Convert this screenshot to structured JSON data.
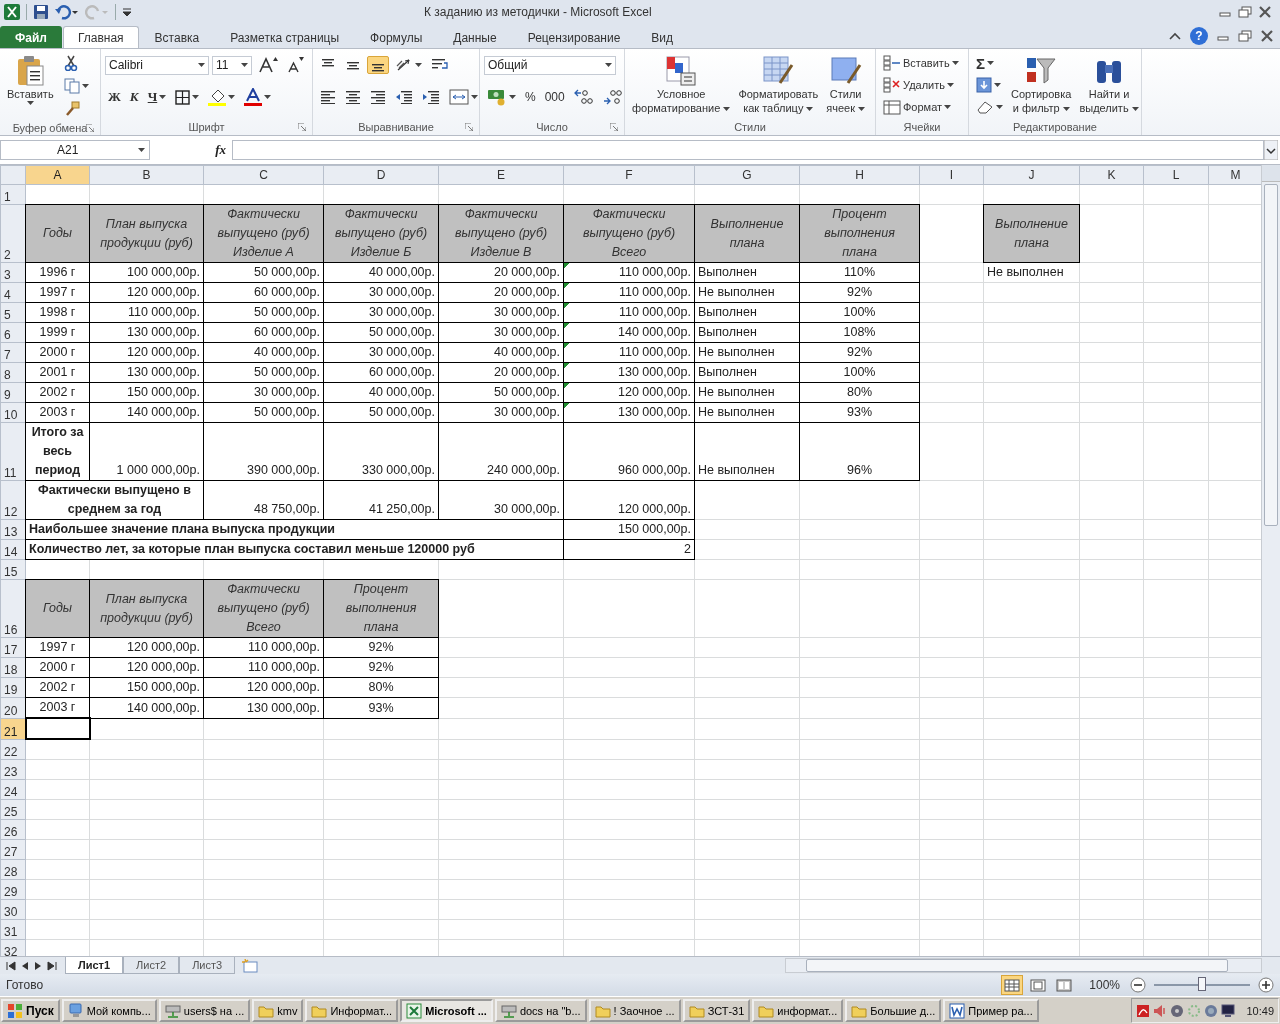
{
  "window": {
    "title": "К заданию из методички  -  Microsoft Excel"
  },
  "ribbon_tabs": [
    {
      "label": "Файл",
      "kind": "file",
      "selected": false
    },
    {
      "label": "Главная",
      "kind": "tab",
      "selected": true
    },
    {
      "label": "Вставка",
      "kind": "tab",
      "selected": false
    },
    {
      "label": "Разметка страницы",
      "kind": "tab",
      "selected": false
    },
    {
      "label": "Формулы",
      "kind": "tab",
      "selected": false
    },
    {
      "label": "Данные",
      "kind": "tab",
      "selected": false
    },
    {
      "label": "Рецензирование",
      "kind": "tab",
      "selected": false
    },
    {
      "label": "Вид",
      "kind": "tab",
      "selected": false
    }
  ],
  "help_button": "?",
  "ribbon_groups": [
    {
      "label": "Буфер обмена",
      "kind": "clipboard",
      "launcher": true,
      "items": [
        {
          "kind": "paste",
          "label": "Вставить",
          "dropdown": true
        },
        {
          "kind": "cut"
        },
        {
          "kind": "copy",
          "dropdown": true
        },
        {
          "kind": "painter"
        }
      ]
    },
    {
      "label": "Шрифт",
      "kind": "font",
      "launcher": true,
      "upper_items": [
        {
          "kind": "font-field",
          "value": "Calibri"
        },
        {
          "kind": "size-field",
          "value": "11"
        },
        {
          "kind": "grow"
        },
        {
          "kind": "shrink"
        }
      ],
      "lower_items": [
        {
          "kind": "bold",
          "label": "Ж"
        },
        {
          "kind": "italic",
          "label": "К"
        },
        {
          "kind": "underline",
          "label": "Ч",
          "dropdown": true
        },
        {
          "kind": "borders",
          "dropdown": true
        },
        {
          "kind": "fill",
          "dropdown": true
        },
        {
          "kind": "font-color",
          "dropdown": true
        }
      ]
    },
    {
      "label": "Выравнивание",
      "kind": "alignment",
      "launcher": true,
      "upper_items": [
        {
          "kind": "align-top",
          "selected": false
        },
        {
          "kind": "align-middle",
          "selected": false
        },
        {
          "kind": "align-bottom",
          "selected": true
        },
        {
          "kind": "orientation",
          "dropdown": true,
          "selected": false
        },
        {
          "kind": "wrap",
          "selected": false
        }
      ],
      "lower_items": [
        {
          "kind": "align-left",
          "selected": false
        },
        {
          "kind": "align-center",
          "selected": false
        },
        {
          "kind": "align-right",
          "selected": false
        },
        {
          "kind": "outdent",
          "selected": false
        },
        {
          "kind": "indent",
          "selected": false
        },
        {
          "kind": "merge",
          "dropdown": true,
          "selected": false
        }
      ]
    },
    {
      "label": "Число",
      "kind": "number",
      "launcher": true,
      "upper_items": [
        {
          "kind": "format-field",
          "value": "Общий"
        }
      ],
      "lower_items": [
        {
          "kind": "currency",
          "dropdown": true
        },
        {
          "kind": "percent",
          "label": "%"
        },
        {
          "kind": "thousands",
          "label": "000"
        },
        {
          "kind": "increase-decimal"
        },
        {
          "kind": "decrease-decimal"
        }
      ]
    },
    {
      "label": "Стили",
      "kind": "styles",
      "items": [
        {
          "kind": "conditional",
          "lines": [
            "Условное",
            "форматирование"
          ],
          "dropdown": true
        },
        {
          "kind": "as-table",
          "lines": [
            "Форматировать",
            "как таблицу"
          ],
          "dropdown": true
        },
        {
          "kind": "cell-styles",
          "lines": [
            "Стили",
            "ячеек"
          ],
          "dropdown": true
        }
      ]
    },
    {
      "label": "Ячейки",
      "kind": "cells",
      "items": [
        {
          "kind": "insert",
          "label": "Вставить",
          "dropdown": true
        },
        {
          "kind": "delete",
          "label": "Удалить",
          "dropdown": true
        },
        {
          "kind": "format",
          "label": "Формат",
          "dropdown": true
        }
      ]
    },
    {
      "label": "Редактирование",
      "kind": "editing",
      "items": [
        {
          "kind": "sum",
          "label": "Σ",
          "dropdown": true
        },
        {
          "kind": "fill-down",
          "dropdown": true
        },
        {
          "kind": "clear",
          "dropdown": true
        },
        {
          "kind": "sort",
          "lines": [
            "Сортировка",
            "и фильтр"
          ],
          "dropdown": true
        },
        {
          "kind": "find",
          "lines": [
            "Найти и",
            "выделить"
          ],
          "dropdown": true
        }
      ]
    }
  ],
  "formula_bar": {
    "name_box": "A21",
    "function_label": "fx"
  },
  "sheet": {
    "columns": [
      {
        "label": "A",
        "selected": true
      },
      {
        "label": "B",
        "selected": false
      },
      {
        "label": "C",
        "selected": false
      },
      {
        "label": "D",
        "selected": false
      },
      {
        "label": "E",
        "selected": false
      },
      {
        "label": "F",
        "selected": false
      },
      {
        "label": "G",
        "selected": false
      },
      {
        "label": "H",
        "selected": false
      },
      {
        "label": "I",
        "selected": false
      },
      {
        "label": "J",
        "selected": false
      },
      {
        "label": "K",
        "selected": false
      },
      {
        "label": "L",
        "selected": false
      },
      {
        "label": "M",
        "selected": false
      }
    ],
    "rows": [
      {
        "number": "1",
        "selected": false,
        "cells": []
      },
      {
        "number": "2",
        "selected": false,
        "cells": [
          {
            "kind": "header",
            "lines": [
              "Годы"
            ]
          },
          {
            "kind": "header",
            "lines": [
              "План выпуска",
              "продукции (руб)"
            ]
          },
          {
            "kind": "header",
            "lines": [
              "Фактически",
              "выпущено (руб)",
              "Изделие А"
            ]
          },
          {
            "kind": "header",
            "lines": [
              "Фактически",
              "выпущено (руб)",
              "Изделие Б"
            ]
          },
          {
            "kind": "header",
            "lines": [
              "Фактически",
              "выпущено (руб)",
              "Изделие В"
            ]
          },
          {
            "kind": "header",
            "lines": [
              "Фактически",
              "выпущено (руб)",
              "Всего"
            ]
          },
          {
            "kind": "header",
            "lines": [
              "Выполнение",
              "плана"
            ]
          },
          {
            "kind": "header",
            "lines": [
              "Процент",
              "выполнения",
              "плана"
            ]
          },
          {
            "kind": "empty"
          },
          {
            "kind": "header",
            "lines": [
              "Выполнение",
              "плана"
            ]
          }
        ]
      },
      {
        "number": "3",
        "selected": false,
        "cells": [
          {
            "kind": "center",
            "text": "1996 г"
          },
          {
            "kind": "num",
            "text": "100 000,00р."
          },
          {
            "kind": "num",
            "text": "50 000,00р."
          },
          {
            "kind": "num",
            "text": "40 000,00р."
          },
          {
            "kind": "num",
            "text": "20 000,00р."
          },
          {
            "kind": "num",
            "text": "110 000,00р.",
            "flag": true
          },
          {
            "kind": "text",
            "text": "Выполнен"
          },
          {
            "kind": "center",
            "text": "110%"
          },
          {
            "kind": "empty"
          },
          {
            "kind": "plain",
            "text": "Не выполнен"
          }
        ]
      },
      {
        "number": "4",
        "selected": false,
        "cells": [
          {
            "kind": "center",
            "text": "1997 г"
          },
          {
            "kind": "num",
            "text": "120 000,00р."
          },
          {
            "kind": "num",
            "text": "60 000,00р."
          },
          {
            "kind": "num",
            "text": "30 000,00р."
          },
          {
            "kind": "num",
            "text": "20 000,00р."
          },
          {
            "kind": "num",
            "text": "110 000,00р.",
            "flag": true
          },
          {
            "kind": "text",
            "text": "Не выполнен"
          },
          {
            "kind": "center",
            "text": "92%"
          }
        ]
      },
      {
        "number": "5",
        "selected": false,
        "cells": [
          {
            "kind": "center",
            "text": "1998 г"
          },
          {
            "kind": "num",
            "text": "110 000,00р."
          },
          {
            "kind": "num",
            "text": "50 000,00р."
          },
          {
            "kind": "num",
            "text": "30 000,00р."
          },
          {
            "kind": "num",
            "text": "30 000,00р."
          },
          {
            "kind": "num",
            "text": "110 000,00р.",
            "flag": true
          },
          {
            "kind": "text",
            "text": "Выполнен"
          },
          {
            "kind": "center",
            "text": "100%"
          }
        ]
      },
      {
        "number": "6",
        "selected": false,
        "cells": [
          {
            "kind": "center",
            "text": "1999 г"
          },
          {
            "kind": "num",
            "text": "130 000,00р."
          },
          {
            "kind": "num",
            "text": "60 000,00р."
          },
          {
            "kind": "num",
            "text": "50 000,00р."
          },
          {
            "kind": "num",
            "text": "30 000,00р."
          },
          {
            "kind": "num",
            "text": "140 000,00р.",
            "flag": true
          },
          {
            "kind": "text",
            "text": "Выполнен"
          },
          {
            "kind": "center",
            "text": "108%"
          }
        ]
      },
      {
        "number": "7",
        "selected": false,
        "cells": [
          {
            "kind": "center",
            "text": "2000 г"
          },
          {
            "kind": "num",
            "text": "120 000,00р."
          },
          {
            "kind": "num",
            "text": "40 000,00р."
          },
          {
            "kind": "num",
            "text": "30 000,00р."
          },
          {
            "kind": "num",
            "text": "40 000,00р."
          },
          {
            "kind": "num",
            "text": "110 000,00р.",
            "flag": true
          },
          {
            "kind": "text",
            "text": "Не выполнен"
          },
          {
            "kind": "center",
            "text": "92%"
          }
        ]
      },
      {
        "number": "8",
        "selected": false,
        "cells": [
          {
            "kind": "center",
            "text": "2001 г"
          },
          {
            "kind": "num",
            "text": "130 000,00р."
          },
          {
            "kind": "num",
            "text": "50 000,00р."
          },
          {
            "kind": "num",
            "text": "60 000,00р."
          },
          {
            "kind": "num",
            "text": "20 000,00р."
          },
          {
            "kind": "num",
            "text": "130 000,00р.",
            "flag": true
          },
          {
            "kind": "text",
            "text": "Выполнен"
          },
          {
            "kind": "center",
            "text": "100%"
          }
        ]
      },
      {
        "number": "9",
        "selected": false,
        "cells": [
          {
            "kind": "center",
            "text": "2002 г"
          },
          {
            "kind": "num",
            "text": "150 000,00р."
          },
          {
            "kind": "num",
            "text": "30 000,00р."
          },
          {
            "kind": "num",
            "text": "40 000,00р."
          },
          {
            "kind": "num",
            "text": "50 000,00р."
          },
          {
            "kind": "num",
            "text": "120 000,00р.",
            "flag": true
          },
          {
            "kind": "text",
            "text": "Не выполнен"
          },
          {
            "kind": "center",
            "text": "80%"
          }
        ]
      },
      {
        "number": "10",
        "selected": false,
        "cells": [
          {
            "kind": "center",
            "text": "2003 г"
          },
          {
            "kind": "num",
            "text": "140 000,00р."
          },
          {
            "kind": "num",
            "text": "50 000,00р."
          },
          {
            "kind": "num",
            "text": "50 000,00р."
          },
          {
            "kind": "num",
            "text": "30 000,00р."
          },
          {
            "kind": "num",
            "text": "130 000,00р.",
            "flag": true
          },
          {
            "kind": "text",
            "text": "Не выполнен"
          },
          {
            "kind": "center",
            "text": "93%"
          }
        ]
      },
      {
        "number": "11",
        "selected": false,
        "cells": [
          {
            "kind": "bold",
            "lines": [
              "Итого за",
              "весь",
              "период"
            ]
          },
          {
            "kind": "num",
            "text": "1 000 000,00р."
          },
          {
            "kind": "num",
            "text": "390 000,00р."
          },
          {
            "kind": "num",
            "text": "330 000,00р."
          },
          {
            "kind": "num",
            "text": "240 000,00р."
          },
          {
            "kind": "num",
            "text": "960 000,00р."
          },
          {
            "kind": "text",
            "text": "Не выполнен"
          },
          {
            "kind": "center",
            "text": "96%"
          }
        ]
      },
      {
        "number": "12",
        "selected": false,
        "cells": [
          {
            "kind": "bold",
            "lines": [
              "Фактически выпущено в",
              "среднем за год"
            ],
            "colspan": 2
          },
          {
            "kind": "num",
            "text": "48 750,00р."
          },
          {
            "kind": "num",
            "text": "41 250,00р."
          },
          {
            "kind": "num",
            "text": "30 000,00р."
          },
          {
            "kind": "num",
            "text": "120 000,00р."
          }
        ]
      },
      {
        "number": "13",
        "selected": false,
        "cells": [
          {
            "kind": "boldleft",
            "text": "Наибольшее значение плана выпуска продукции",
            "colspan": 5
          },
          {
            "kind": "num",
            "text": "150 000,00р."
          }
        ]
      },
      {
        "number": "14",
        "selected": false,
        "cells": [
          {
            "kind": "boldleft",
            "text": "Количество лет, за которые план выпуска составил меньше 120000 руб",
            "colspan": 5
          },
          {
            "kind": "num",
            "text": "2"
          }
        ]
      },
      {
        "number": "15",
        "selected": false,
        "cells": []
      },
      {
        "number": "16",
        "selected": false,
        "cells": [
          {
            "kind": "header",
            "lines": [
              "Годы"
            ]
          },
          {
            "kind": "header",
            "lines": [
              "План выпуска",
              "продукции (руб)"
            ]
          },
          {
            "kind": "header",
            "lines": [
              "Фактически",
              "выпущено (руб)",
              "Всего"
            ]
          },
          {
            "kind": "header",
            "lines": [
              "Процент",
              "выполнения",
              "плана"
            ]
          }
        ]
      },
      {
        "number": "17",
        "selected": false,
        "cells": [
          {
            "kind": "center",
            "text": "1997 г"
          },
          {
            "kind": "num",
            "text": "120 000,00р."
          },
          {
            "kind": "num",
            "text": "110 000,00р."
          },
          {
            "kind": "center",
            "text": "92%"
          }
        ]
      },
      {
        "number": "18",
        "selected": false,
        "cells": [
          {
            "kind": "center",
            "text": "2000 г"
          },
          {
            "kind": "num",
            "text": "120 000,00р."
          },
          {
            "kind": "num",
            "text": "110 000,00р."
          },
          {
            "kind": "center",
            "text": "92%"
          }
        ]
      },
      {
        "number": "19",
        "selected": false,
        "cells": [
          {
            "kind": "center",
            "text": "2002 г"
          },
          {
            "kind": "num",
            "text": "150 000,00р."
          },
          {
            "kind": "num",
            "text": "120 000,00р."
          },
          {
            "kind": "center",
            "text": "80%"
          }
        ]
      },
      {
        "number": "20",
        "selected": false,
        "cells": [
          {
            "kind": "center",
            "text": "2003 г"
          },
          {
            "kind": "num",
            "text": "140 000,00р."
          },
          {
            "kind": "num",
            "text": "130 000,00р."
          },
          {
            "kind": "center",
            "text": "93%"
          }
        ]
      },
      {
        "number": "21",
        "selected": true,
        "cells": [
          {
            "kind": "empty",
            "active": true
          }
        ]
      },
      {
        "number": "22",
        "selected": false,
        "cells": []
      },
      {
        "number": "23",
        "selected": false,
        "cells": []
      },
      {
        "number": "24",
        "selected": false,
        "cells": []
      },
      {
        "number": "25",
        "selected": false,
        "cells": []
      },
      {
        "number": "26",
        "selected": false,
        "cells": []
      },
      {
        "number": "27",
        "selected": false,
        "cells": []
      },
      {
        "number": "28",
        "selected": false,
        "cells": []
      },
      {
        "number": "29",
        "selected": false,
        "cells": []
      },
      {
        "number": "30",
        "selected": false,
        "cells": []
      },
      {
        "number": "31",
        "selected": false,
        "cells": []
      },
      {
        "number": "32",
        "selected": false,
        "cells": []
      }
    ]
  },
  "sheet_tabs": [
    {
      "label": "Лист1",
      "selected": true
    },
    {
      "label": "Лист2",
      "selected": false
    },
    {
      "label": "Лист3",
      "selected": false
    }
  ],
  "status_bar": {
    "status": "Готово",
    "views": [
      {
        "kind": "normal",
        "selected": true
      },
      {
        "kind": "page-layout",
        "selected": false
      },
      {
        "kind": "page-break",
        "selected": false
      }
    ],
    "zoom": "100%",
    "zoom_slider": {
      "level": 0.5
    }
  },
  "taskbar": {
    "start": "Пуск",
    "tasks": [
      {
        "kind": "computer",
        "label": "Мой компь...",
        "selected": false
      },
      {
        "kind": "network",
        "label": "users$ на ...",
        "selected": false
      },
      {
        "kind": "folder",
        "label": "kmv",
        "selected": false
      },
      {
        "kind": "folder",
        "label": "Информат...",
        "selected": false
      },
      {
        "kind": "excel",
        "label": "Microsoft ...",
        "selected": true
      },
      {
        "kind": "network",
        "label": "docs на \"b...",
        "selected": false
      },
      {
        "kind": "folder",
        "label": "! Заочное ...",
        "selected": false
      },
      {
        "kind": "folder",
        "label": "ЗСТ-31",
        "selected": false
      },
      {
        "kind": "folder",
        "label": "информат...",
        "selected": false
      },
      {
        "kind": "folder",
        "label": "Большие д...",
        "selected": false
      },
      {
        "kind": "word",
        "label": "Пример ра...",
        "selected": false
      }
    ],
    "clock": "10:49"
  }
}
